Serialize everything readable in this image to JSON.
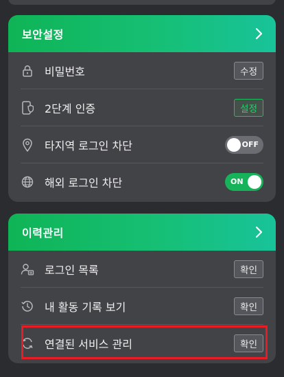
{
  "security": {
    "title": "보안설정",
    "items": [
      {
        "label": "비밀번호",
        "icon": "lock-icon",
        "control": "button",
        "button_label": "수정"
      },
      {
        "label": "2단계 인증",
        "icon": "phone-shield-icon",
        "control": "button",
        "button_label": "설정",
        "button_style": "green"
      },
      {
        "label": "타지역 로그인 차단",
        "icon": "location-pin-icon",
        "control": "toggle",
        "toggle_label": "OFF",
        "state": "off"
      },
      {
        "label": "해외 로그인 차단",
        "icon": "globe-icon",
        "control": "toggle",
        "toggle_label": "ON",
        "state": "on"
      }
    ]
  },
  "history": {
    "title": "이력관리",
    "items": [
      {
        "label": "로그인 목록",
        "icon": "user-list-icon",
        "button_label": "확인"
      },
      {
        "label": "내 활동 기록 보기",
        "icon": "history-icon",
        "button_label": "확인"
      },
      {
        "label": "연결된 서비스 관리",
        "icon": "sync-icon",
        "button_label": "확인",
        "highlighted": true
      }
    ]
  },
  "colors": {
    "background": "#2b2c30",
    "card": "#424347",
    "accent_green": "#16b35a",
    "highlight_red": "#e81c24"
  }
}
